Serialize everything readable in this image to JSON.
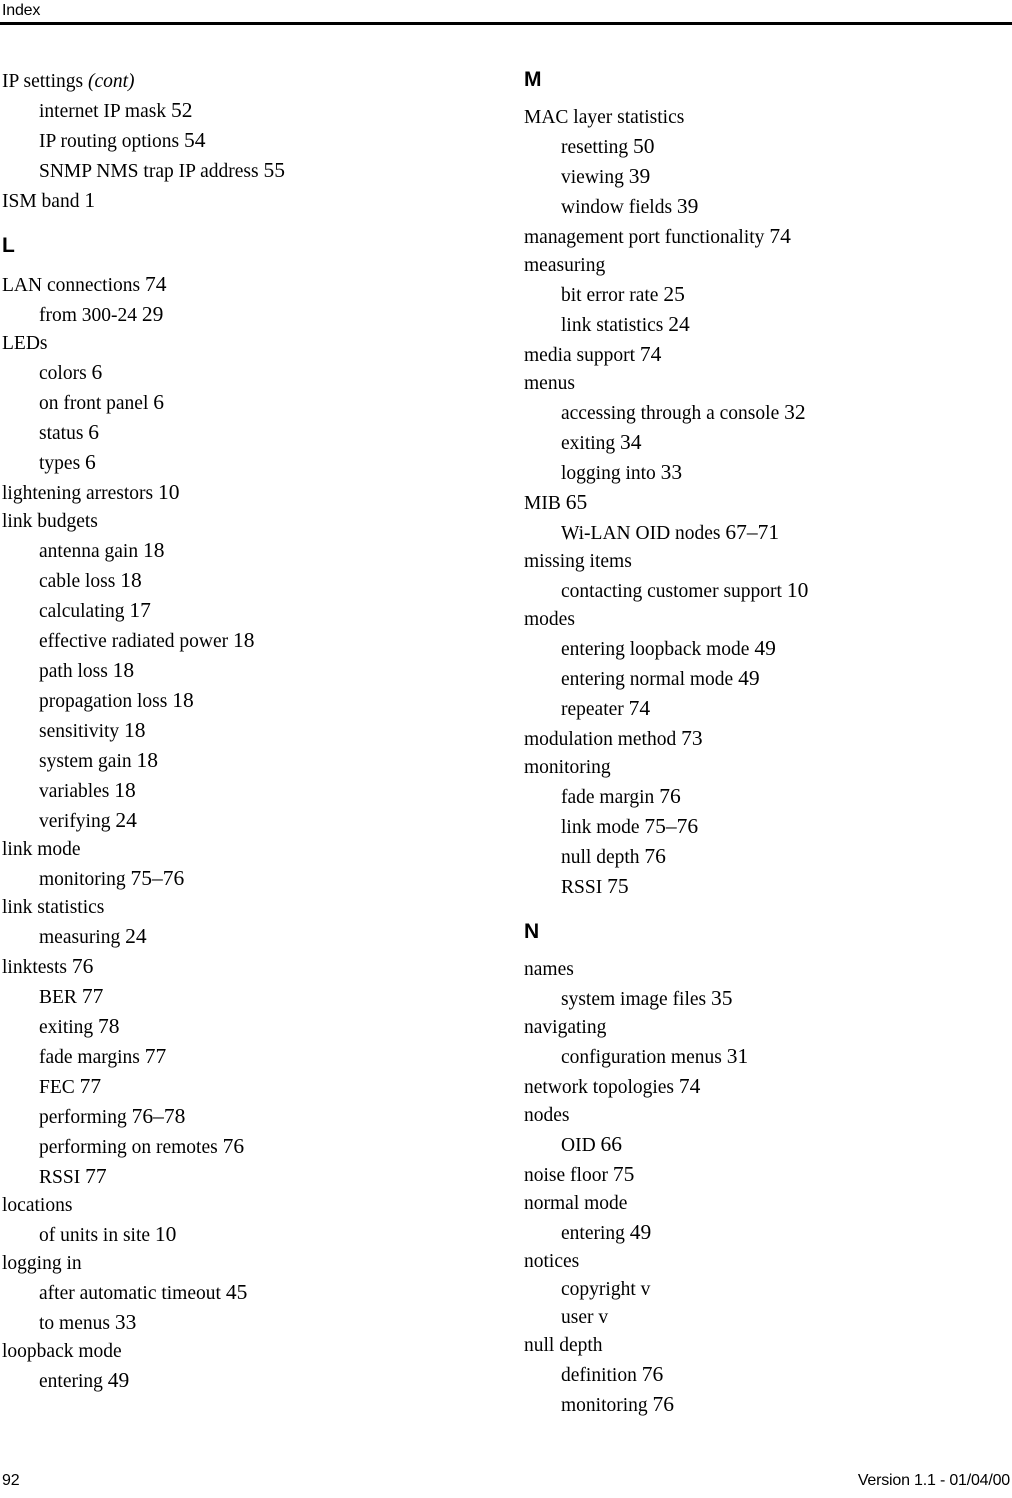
{
  "header": {
    "title": "Index"
  },
  "footer": {
    "page_number": "92",
    "version": "Version 1.1 - 01/04/00"
  },
  "columns": [
    {
      "name": "left-column",
      "blocks": [
        {
          "type": "entries",
          "entries": [
            {
              "level": 0,
              "term": "IP settings ",
              "cont": "(cont)",
              "pages": ""
            },
            {
              "level": 1,
              "term": "internet IP mask ",
              "pages": "52"
            },
            {
              "level": 1,
              "term": "IP routing options ",
              "pages": "54"
            },
            {
              "level": 1,
              "term": "SNMP NMS trap IP address ",
              "pages": "55"
            },
            {
              "level": 0,
              "term": "ISM band ",
              "pages": "1"
            }
          ]
        },
        {
          "type": "letter",
          "letter": "L"
        },
        {
          "type": "entries",
          "entries": [
            {
              "level": 0,
              "term": "LAN connections ",
              "pages": "74"
            },
            {
              "level": 1,
              "term": "from 300-24 ",
              "pages": "29"
            },
            {
              "level": 0,
              "term": "LEDs",
              "pages": ""
            },
            {
              "level": 1,
              "term": "colors ",
              "pages": "6"
            },
            {
              "level": 1,
              "term": "on front panel ",
              "pages": "6"
            },
            {
              "level": 1,
              "term": "status ",
              "pages": "6"
            },
            {
              "level": 1,
              "term": "types ",
              "pages": "6"
            },
            {
              "level": 0,
              "term": "lightening arrestors ",
              "pages": "10"
            },
            {
              "level": 0,
              "term": "link budgets",
              "pages": ""
            },
            {
              "level": 1,
              "term": "antenna gain ",
              "pages": "18"
            },
            {
              "level": 1,
              "term": "cable loss ",
              "pages": "18"
            },
            {
              "level": 1,
              "term": "calculating ",
              "pages": "17"
            },
            {
              "level": 1,
              "term": "effective radiated power ",
              "pages": "18"
            },
            {
              "level": 1,
              "term": "path loss ",
              "pages": "18"
            },
            {
              "level": 1,
              "term": "propagation loss ",
              "pages": "18"
            },
            {
              "level": 1,
              "term": "sensitivity ",
              "pages": "18"
            },
            {
              "level": 1,
              "term": "system gain ",
              "pages": "18"
            },
            {
              "level": 1,
              "term": "variables ",
              "pages": "18"
            },
            {
              "level": 1,
              "term": "verifying ",
              "pages": "24"
            },
            {
              "level": 0,
              "term": "link mode",
              "pages": ""
            },
            {
              "level": 1,
              "term": "monitoring ",
              "pages": "75–76"
            },
            {
              "level": 0,
              "term": "link statistics",
              "pages": ""
            },
            {
              "level": 1,
              "term": "measuring ",
              "pages": "24"
            },
            {
              "level": 0,
              "term": "linktests ",
              "pages": "76"
            },
            {
              "level": 1,
              "term": "BER ",
              "pages": "77"
            },
            {
              "level": 1,
              "term": "exiting ",
              "pages": "78"
            },
            {
              "level": 1,
              "term": "fade margins ",
              "pages": "77"
            },
            {
              "level": 1,
              "term": "FEC ",
              "pages": "77"
            },
            {
              "level": 1,
              "term": "performing ",
              "pages": "76–78"
            },
            {
              "level": 1,
              "term": "performing on remotes ",
              "pages": "76"
            },
            {
              "level": 1,
              "term": "RSSI ",
              "pages": "77"
            },
            {
              "level": 0,
              "term": "locations",
              "pages": ""
            },
            {
              "level": 1,
              "term": "of units in site ",
              "pages": "10"
            },
            {
              "level": 0,
              "term": "logging in",
              "pages": ""
            },
            {
              "level": 1,
              "term": "after automatic timeout ",
              "pages": "45"
            },
            {
              "level": 1,
              "term": "to menus ",
              "pages": "33"
            },
            {
              "level": 0,
              "term": "loopback mode",
              "pages": ""
            },
            {
              "level": 1,
              "term": "entering ",
              "pages": "49"
            }
          ]
        }
      ]
    },
    {
      "name": "right-column",
      "blocks": [
        {
          "type": "letter",
          "letter": "M",
          "first": true
        },
        {
          "type": "entries",
          "entries": [
            {
              "level": 0,
              "term": "MAC layer statistics",
              "pages": ""
            },
            {
              "level": 1,
              "term": "resetting ",
              "pages": "50"
            },
            {
              "level": 1,
              "term": "viewing ",
              "pages": "39"
            },
            {
              "level": 1,
              "term": "window fields ",
              "pages": "39"
            },
            {
              "level": 0,
              "term": "management port functionality ",
              "pages": "74"
            },
            {
              "level": 0,
              "term": "measuring",
              "pages": ""
            },
            {
              "level": 1,
              "term": "bit error rate ",
              "pages": "25"
            },
            {
              "level": 1,
              "term": "link statistics ",
              "pages": "24"
            },
            {
              "level": 0,
              "term": "media support ",
              "pages": "74"
            },
            {
              "level": 0,
              "term": "menus",
              "pages": ""
            },
            {
              "level": 1,
              "term": "accessing through a console ",
              "pages": "32"
            },
            {
              "level": 1,
              "term": "exiting ",
              "pages": "34"
            },
            {
              "level": 1,
              "term": "logging into ",
              "pages": "33"
            },
            {
              "level": 0,
              "term": "MIB ",
              "pages": "65"
            },
            {
              "level": 1,
              "term": "Wi-LAN OID nodes ",
              "pages": "67–71"
            },
            {
              "level": 0,
              "term": "missing items",
              "pages": ""
            },
            {
              "level": 1,
              "term": "contacting customer support ",
              "pages": "10"
            },
            {
              "level": 0,
              "term": "modes",
              "pages": ""
            },
            {
              "level": 1,
              "term": "entering loopback mode ",
              "pages": "49"
            },
            {
              "level": 1,
              "term": "entering normal mode ",
              "pages": "49"
            },
            {
              "level": 1,
              "term": "repeater ",
              "pages": "74"
            },
            {
              "level": 0,
              "term": "modulation method ",
              "pages": "73"
            },
            {
              "level": 0,
              "term": "monitoring",
              "pages": ""
            },
            {
              "level": 1,
              "term": "fade margin ",
              "pages": "76"
            },
            {
              "level": 1,
              "term": "link mode ",
              "pages": "75–76"
            },
            {
              "level": 1,
              "term": "null depth ",
              "pages": "76"
            },
            {
              "level": 1,
              "term": "RSSI ",
              "pages": "75"
            }
          ]
        },
        {
          "type": "letter",
          "letter": "N"
        },
        {
          "type": "entries",
          "entries": [
            {
              "level": 0,
              "term": "names",
              "pages": ""
            },
            {
              "level": 1,
              "term": "system image files ",
              "pages": "35"
            },
            {
              "level": 0,
              "term": "navigating",
              "pages": ""
            },
            {
              "level": 1,
              "term": "configuration menus ",
              "pages": "31"
            },
            {
              "level": 0,
              "term": "network topologies ",
              "pages": "74"
            },
            {
              "level": 0,
              "term": "nodes",
              "pages": ""
            },
            {
              "level": 1,
              "term": "OID ",
              "pages": "66"
            },
            {
              "level": 0,
              "term": "noise floor ",
              "pages": "75"
            },
            {
              "level": 0,
              "term": "normal mode",
              "pages": ""
            },
            {
              "level": 1,
              "term": "entering ",
              "pages": "49"
            },
            {
              "level": 0,
              "term": "notices",
              "pages": ""
            },
            {
              "level": 1,
              "term": "copyright ",
              "pages": "v",
              "roman": true
            },
            {
              "level": 1,
              "term": "user ",
              "pages": "v",
              "roman": true
            },
            {
              "level": 0,
              "term": "null depth",
              "pages": ""
            },
            {
              "level": 1,
              "term": "definition ",
              "pages": "76"
            },
            {
              "level": 1,
              "term": "monitoring ",
              "pages": "76"
            }
          ]
        }
      ]
    }
  ]
}
